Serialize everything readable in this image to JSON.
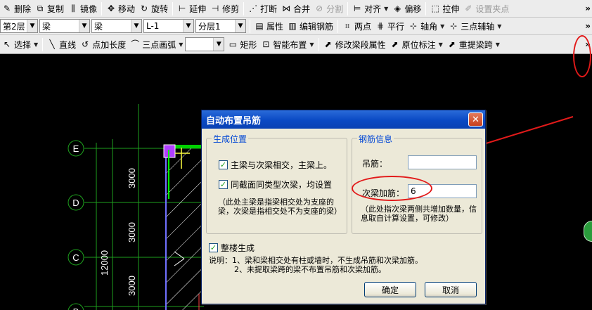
{
  "toolbar1": [
    {
      "label": "删除",
      "icon": "delete-icon",
      "glyph": "✎"
    },
    {
      "label": "复制",
      "icon": "copy-icon",
      "glyph": "⧉"
    },
    {
      "label": "镜像",
      "icon": "mirror-icon",
      "glyph": "⫼"
    },
    {
      "label": "移动",
      "icon": "move-icon",
      "glyph": "✥"
    },
    {
      "label": "旋转",
      "icon": "rotate-icon",
      "glyph": "↻"
    },
    {
      "label": "延伸",
      "icon": "extend-icon",
      "glyph": "⊢"
    },
    {
      "label": "修剪",
      "icon": "trim-icon",
      "glyph": "⊣"
    },
    {
      "label": "打断",
      "icon": "break-icon",
      "glyph": "⋰"
    },
    {
      "label": "合并",
      "icon": "merge-icon",
      "glyph": "⋈"
    },
    {
      "label": "分割",
      "icon": "split-icon",
      "glyph": "⊘",
      "disabled": true
    },
    {
      "label": "对齐",
      "icon": "align-icon",
      "glyph": "⊨",
      "dropdown": true
    },
    {
      "label": "偏移",
      "icon": "offset-icon",
      "glyph": "◈"
    },
    {
      "label": "拉伸",
      "icon": "stretch-icon",
      "glyph": "⬚"
    },
    {
      "label": "设置夹点",
      "icon": "set-grip-icon",
      "glyph": "✐",
      "disabled": true
    }
  ],
  "toolbar2": {
    "floor": "第2层",
    "category": "梁",
    "type": "梁",
    "name": "L-1",
    "layer": "分层1",
    "buttons": [
      {
        "label": "属性",
        "icon": "property-icon",
        "glyph": "▤"
      },
      {
        "label": "编辑钢筋",
        "icon": "edit-rebar-icon",
        "glyph": "▥"
      },
      {
        "label": "两点",
        "icon": "two-point-icon",
        "glyph": "⌗"
      },
      {
        "label": "平行",
        "icon": "parallel-icon",
        "glyph": "⋕"
      },
      {
        "label": "轴角",
        "icon": "axis-angle-icon",
        "glyph": "⊹",
        "dropdown": true
      },
      {
        "label": "三点辅轴",
        "icon": "three-point-axis-icon",
        "glyph": "⊹",
        "dropdown": true
      }
    ]
  },
  "toolbar3": [
    {
      "label": "选择",
      "icon": "select-icon",
      "glyph": "↖",
      "dropdown": true
    },
    {
      "label": "直线",
      "icon": "line-icon",
      "glyph": "╲"
    },
    {
      "label": "点加长度",
      "icon": "point-length-icon",
      "glyph": "↺"
    },
    {
      "label": "三点画弧",
      "icon": "arc-icon",
      "glyph": "⌒",
      "dropdown": true
    },
    {
      "label": "矩形",
      "icon": "rect-icon",
      "glyph": "▭"
    },
    {
      "label": "智能布置",
      "icon": "smart-layout-icon",
      "glyph": "⊡",
      "dropdown": true
    },
    {
      "label": "修改梁段属性",
      "icon": "modify-beam-icon",
      "glyph": "⬈"
    },
    {
      "label": "原位标注",
      "icon": "in-situ-mark-icon",
      "glyph": "⬈",
      "dropdown": true
    },
    {
      "label": "重提梁跨",
      "icon": "re-extract-span-icon",
      "glyph": "⬈",
      "dropdown": true
    }
  ],
  "more_glyph": "»",
  "canvas": {
    "axes": [
      "E",
      "D",
      "C",
      "B"
    ],
    "dims": [
      "3000",
      "3000",
      "3000"
    ],
    "total_dim": "12000"
  },
  "dialog": {
    "title": "自动布置吊筋",
    "close_glyph": "✕",
    "position_group": "生成位置",
    "opt_main_secondary": "主梁与次梁相交，主梁上。",
    "opt_same_section": "同截面同类型次梁，均设置",
    "note_main": "（此处主梁是指梁相交处为支座的梁，次梁是指相交处不为支座的梁）",
    "rebar_group": "钢筋信息",
    "hanger_label": "吊筋：",
    "hanger_value": "",
    "extra_label": "次梁加筋：",
    "extra_value": "6",
    "note_extra": "（此处指次梁两侧共增加数量，信息取自计算设置，可修改）",
    "whole_floor": "整楼生成",
    "desc_1": "说明：1、梁和梁相交处有柱或墙时，不生成吊筋和次梁加筋。",
    "desc_2": "2、未提取梁跨的梁不布置吊筋和次梁加筋。",
    "ok": "确定",
    "cancel": "取消",
    "check_glyph": "✓"
  }
}
